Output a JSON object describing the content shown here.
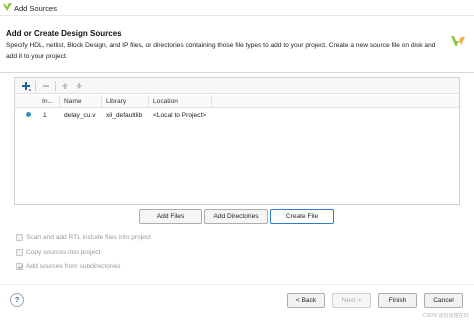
{
  "window": {
    "title": "Add Sources"
  },
  "header": {
    "title": "Add or Create Design Sources",
    "description": "Specify HDL, netlist, Block Design, and IP files, or directories containing those file types to add to your project. Create a new source file on disk and add it to your project."
  },
  "toolbar": {
    "icons": [
      "add-icon",
      "remove-icon",
      "move-up-icon",
      "move-down-icon"
    ]
  },
  "table": {
    "columns": [
      "In...",
      "Name",
      "Library",
      "Location"
    ],
    "rows": [
      {
        "index": "1",
        "name": "delay_cu.v",
        "library": "xil_defaultlib",
        "location": "<Local to Project>"
      }
    ]
  },
  "actions": {
    "add_files": "Add Files",
    "add_directories": "Add Directories",
    "create_file": "Create File"
  },
  "options": [
    {
      "label": "Scan and add RTL include files into project",
      "checked": false
    },
    {
      "label": "Copy sources into project",
      "checked": false
    },
    {
      "label": "Add sources from subdirectories",
      "checked": true
    }
  ],
  "footer": {
    "help": "?",
    "back": "< Back",
    "next": "Next >",
    "finish": "Finish",
    "cancel": "Cancel"
  },
  "watermark": "CSDN @好运常在01",
  "colors": {
    "accent": "#2f7bd2",
    "status_dot": "#3c8dbc",
    "logo_green": "#8cc63f"
  }
}
